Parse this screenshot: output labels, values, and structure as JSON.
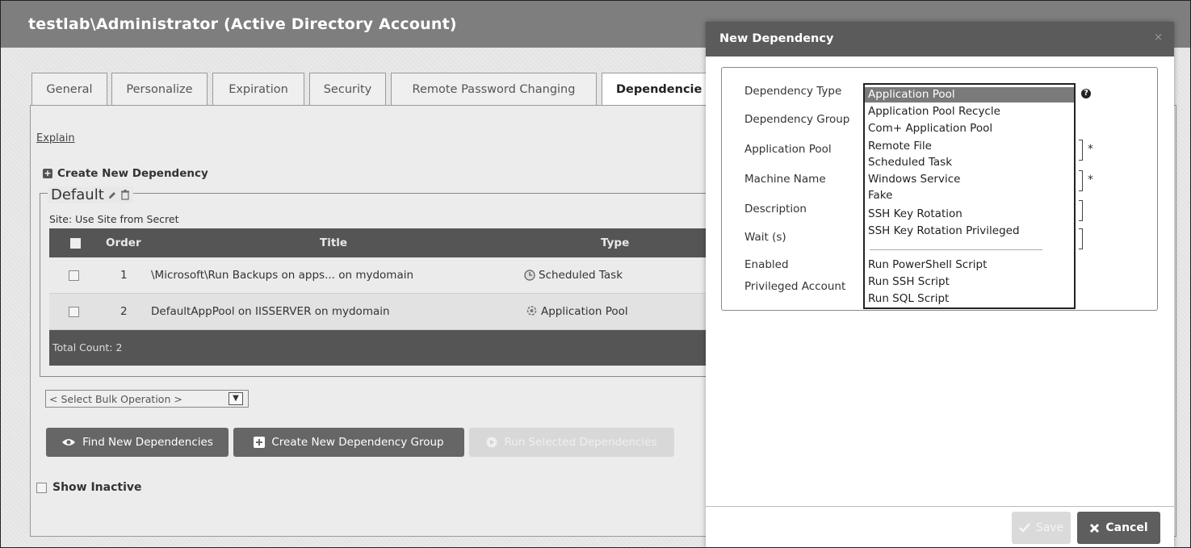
{
  "window": {
    "title": "testlab\\Administrator (Active Directory Account)"
  },
  "tabs": [
    {
      "label": "General"
    },
    {
      "label": "Personalize"
    },
    {
      "label": "Expiration"
    },
    {
      "label": "Security"
    },
    {
      "label": "Remote Password Changing"
    },
    {
      "label": "Dependencie"
    }
  ],
  "panel": {
    "explain_link": "Explain",
    "create_dependency": "Create New Dependency",
    "group_name": "Default",
    "site_line": "Site: Use Site from Secret",
    "grid": {
      "headers": {
        "order": "Order",
        "title": "Title",
        "type": "Type"
      },
      "rows": [
        {
          "order": "1",
          "title": "\\Microsoft\\Run Backups on apps... on mydomain",
          "type": "Scheduled Task",
          "type_icon": "clock-icon"
        },
        {
          "order": "2",
          "title": "DefaultAppPool on IISSERVER on mydomain",
          "type": "Application Pool",
          "type_icon": "app-pool-icon"
        }
      ],
      "total": "Total Count: 2"
    },
    "bulk_select": "< Select Bulk Operation >",
    "buttons": {
      "find": "Find New Dependencies",
      "create_group": "Create New Dependency Group",
      "run_selected": "Run Selected Dependencies"
    },
    "show_inactive": "Show Inactive"
  },
  "modal": {
    "title": "New Dependency",
    "close": "×",
    "labels": {
      "dependency_type": "Dependency Type",
      "dependency_group": "Dependency Group",
      "application_pool": "Application Pool",
      "machine_name": "Machine Name",
      "description": "Description",
      "wait": "Wait (s)",
      "enabled": "Enabled",
      "privileged_account": "Privileged Account"
    },
    "dropdown_options": [
      "Application Pool",
      "Application Pool Recycle",
      "Com+ Application Pool",
      "Remote File",
      "Scheduled Task",
      "Windows Service",
      "Fake",
      "SSH Key Rotation",
      "SSH Key Rotation Privileged",
      "Run PowerShell Script",
      "Run SSH Script",
      "Run SQL Script"
    ],
    "selected_option": "Application Pool",
    "required_marker": "*",
    "help": "?",
    "save": "Save",
    "cancel": "Cancel"
  },
  "colors": {
    "titlebar": "#7e7e7e",
    "modal_header": "#5b5b5b",
    "grid_header": "#555555",
    "selected_option": "#7a7a7a"
  }
}
